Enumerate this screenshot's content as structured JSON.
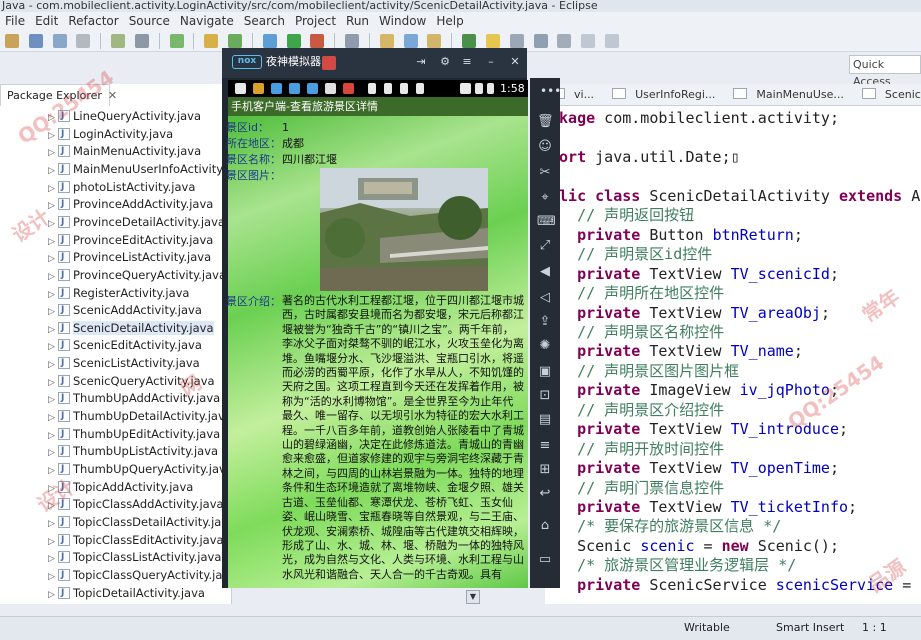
{
  "window": {
    "title": "Java - com.mobileclient.activity.LoginActivity/src/com/mobileclient/activity/ScenicDetailActivity.java - Eclipse"
  },
  "menu": [
    "File",
    "Edit",
    "Refactor",
    "Source",
    "Navigate",
    "Search",
    "Project",
    "Run",
    "Window",
    "Help"
  ],
  "quick_access": {
    "placeholder": "Quick Access"
  },
  "package_explorer": {
    "tab_label": "Package Explorer",
    "close": "✕",
    "files": [
      "LineQueryActivity.java",
      "LoginActivity.java",
      "MainMenuActivity.java",
      "MainMenuUserInfoActivity.java",
      "photoListActivity.java",
      "ProvinceAddActivity.java",
      "ProvinceDetailActivity.java",
      "ProvinceEditActivity.java",
      "ProvinceListActivity.java",
      "ProvinceQueryActivity.java",
      "RegisterActivity.java",
      "ScenicAddActivity.java",
      "ScenicDetailActivity.java",
      "ScenicEditActivity.java",
      "ScenicListActivity.java",
      "ScenicQueryActivity.java",
      "ThumbUpAddActivity.java",
      "ThumbUpDetailActivity.java",
      "ThumbUpEditActivity.java",
      "ThumbUpListActivity.java",
      "ThumbUpQueryActivity.java",
      "TopicAddActivity.java",
      "TopicClassAddActivity.java",
      "TopicClassDetailActivity.java",
      "TopicClassEditActivity.java",
      "TopicClassListActivity.java",
      "TopicClassQueryActivity.java",
      "TopicDetailActivity.java"
    ],
    "selected_index": 12
  },
  "editor_tabs": [
    "vi...",
    "UserInfoRegi...",
    "MainMenuUse...",
    "ScenicListAc..."
  ],
  "code_lines": [
    {
      "parts": [
        {
          "c": "kw",
          "t": "ckage"
        },
        {
          "c": "",
          "t": " com.mobileclient.activity;"
        }
      ]
    },
    {
      "parts": [
        {
          "c": "",
          "t": " "
        }
      ]
    },
    {
      "parts": [
        {
          "c": "kw",
          "t": "port"
        },
        {
          "c": "",
          "t": " java.util.Date;"
        },
        {
          "c": "",
          "t": "▯"
        }
      ]
    },
    {
      "parts": [
        {
          "c": "",
          "t": " "
        }
      ]
    },
    {
      "parts": [
        {
          "c": "kw",
          "t": "blic class"
        },
        {
          "c": "",
          "t": " ScenicDetailActivity "
        },
        {
          "c": "kw",
          "t": "extends"
        },
        {
          "c": "",
          "t": " Ac"
        }
      ]
    },
    {
      "parts": [
        {
          "c": "cm",
          "t": "   // 声明返回按钮"
        }
      ]
    },
    {
      "parts": [
        {
          "c": "kw",
          "t": "   private"
        },
        {
          "c": "",
          "t": " Button "
        },
        {
          "c": "fd",
          "t": "btnReturn"
        },
        {
          "c": "",
          "t": ";"
        }
      ]
    },
    {
      "parts": [
        {
          "c": "cm",
          "t": "   // 声明景区id控件"
        }
      ]
    },
    {
      "parts": [
        {
          "c": "kw",
          "t": "   private"
        },
        {
          "c": "",
          "t": " TextView "
        },
        {
          "c": "fd",
          "t": "TV_scenicId"
        },
        {
          "c": "",
          "t": ";"
        }
      ]
    },
    {
      "parts": [
        {
          "c": "cm",
          "t": "   // 声明所在地区控件"
        }
      ]
    },
    {
      "parts": [
        {
          "c": "kw",
          "t": "   private"
        },
        {
          "c": "",
          "t": " TextView "
        },
        {
          "c": "fd",
          "t": "TV_areaObj"
        },
        {
          "c": "",
          "t": ";"
        }
      ]
    },
    {
      "parts": [
        {
          "c": "cm",
          "t": "   // 声明景区名称控件"
        }
      ]
    },
    {
      "parts": [
        {
          "c": "kw",
          "t": "   private"
        },
        {
          "c": "",
          "t": " TextView "
        },
        {
          "c": "fd",
          "t": "TV_name"
        },
        {
          "c": "",
          "t": ";"
        }
      ]
    },
    {
      "parts": [
        {
          "c": "cm",
          "t": "   // 声明景区图片图片框"
        }
      ]
    },
    {
      "parts": [
        {
          "c": "kw",
          "t": "   private"
        },
        {
          "c": "",
          "t": " ImageView "
        },
        {
          "c": "fd",
          "t": "iv_jqPhoto"
        },
        {
          "c": "",
          "t": ";"
        }
      ]
    },
    {
      "parts": [
        {
          "c": "cm",
          "t": "   // 声明景区介绍控件"
        }
      ]
    },
    {
      "parts": [
        {
          "c": "kw",
          "t": "   private"
        },
        {
          "c": "",
          "t": " TextView "
        },
        {
          "c": "fd",
          "t": "TV_introduce"
        },
        {
          "c": "",
          "t": ";"
        }
      ]
    },
    {
      "parts": [
        {
          "c": "cm",
          "t": "   // 声明开放时间控件"
        }
      ]
    },
    {
      "parts": [
        {
          "c": "kw",
          "t": "   private"
        },
        {
          "c": "",
          "t": " TextView "
        },
        {
          "c": "fd",
          "t": "TV_openTime"
        },
        {
          "c": "",
          "t": ";"
        }
      ]
    },
    {
      "parts": [
        {
          "c": "cm",
          "t": "   // 声明门票信息控件"
        }
      ]
    },
    {
      "parts": [
        {
          "c": "kw",
          "t": "   private"
        },
        {
          "c": "",
          "t": " TextView "
        },
        {
          "c": "fd",
          "t": "TV_ticketInfo"
        },
        {
          "c": "",
          "t": ";"
        }
      ]
    },
    {
      "parts": [
        {
          "c": "cn",
          "t": "   /* 要保存的旅游景区信息 */"
        }
      ]
    },
    {
      "parts": [
        {
          "c": "",
          "t": "   Scenic "
        },
        {
          "c": "fd",
          "t": "scenic"
        },
        {
          "c": "",
          "t": " = "
        },
        {
          "c": "kw",
          "t": "new"
        },
        {
          "c": "",
          "t": " Scenic();"
        }
      ]
    },
    {
      "parts": [
        {
          "c": "cn",
          "t": "   /* 旅游景区管理业务逻辑层 */"
        }
      ]
    },
    {
      "parts": [
        {
          "c": "kw",
          "t": "   private"
        },
        {
          "c": "",
          "t": " ScenicService "
        },
        {
          "c": "fd",
          "t": "scenicService"
        },
        {
          "c": "",
          "t": " = ne"
        }
      ]
    }
  ],
  "emulator": {
    "logo": "nox",
    "name": "夜神模拟器",
    "status_time": "1:58",
    "app_title": "手机客户端-查看旅游景区详情",
    "fields": {
      "id_label": "景区id：",
      "id_value": "1",
      "area_label": "所在地区：",
      "area_value": "成都",
      "name_label": "景区名称：",
      "name_value": "四川都江堰",
      "photo_label": "景区图片：",
      "intro_label": "景区介绍：",
      "intro_value": "著名的古代水利工程都江堰，位于四川都江堰市城西，古时属都安县境而名为都安堰，宋元后称都江堰被誉为“独奇千古”的“镇川之宝”。两千年前，李冰父子面对桀骜不驯的岷江水，火攻玉垒化为离堆。鱼嘴堰分水、飞沙堰溢洪、宝瓶口引水，将遥而必涝的西蜀平原，化作了水旱从人，不知饥馑的天府之国。这项工程直到今天还在发挥着作用，被称为“活的水利博物馆”。是全世界至今为止年代最久、唯一留存、以无坝引水为特征的宏大水利工程。一千八百多年前，道教创始人张陵看中了青城山的碧绿涵幽，决定在此修炼道法。青城山的青幽愈来愈盛，但道家修建的观宇与旁洞宅终深藏于青林之间，与四周的山林岩景融为一体。独特的地理条件和生态环境造就了离堆物峡、金堰夕照、雄关古道、玉垒仙都、寒潭伏龙、苍桥飞虹、玉女仙姿、岷山晓雪、宝瓶春晓等自然景观，与二王庙、伏龙观、安澜索桥、城隍庙等古代建筑交相辉映，形成了山、水、城、林、堰、桥融为一体的独特风光，成为自然与文化、人类与环境、水利工程与山水风光和谐融合、天人合一的千古奇观。具有"
    }
  },
  "status": {
    "writable": "Writable",
    "insert": "Smart Insert",
    "position": "1 : 1"
  },
  "watermarks": [
    "QQ:25454",
    "设计",
    "常年",
    "QQ:25454",
    "设计",
    "网",
    "品源"
  ]
}
